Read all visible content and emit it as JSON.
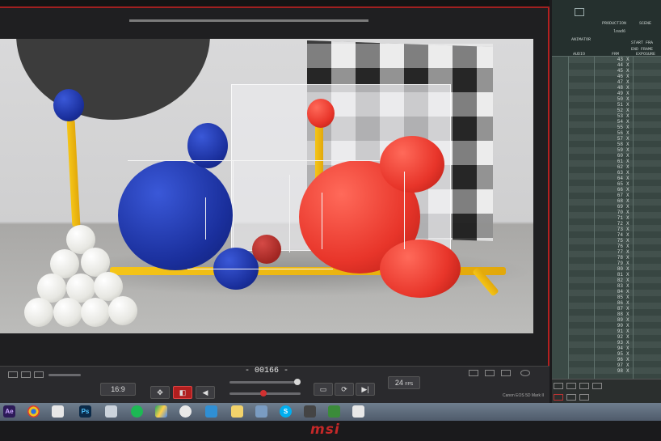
{
  "viewer": {
    "frame_counter": "- 00166 -",
    "aspect_label": "16:9",
    "fps_value": "24",
    "fps_unit": "FPS",
    "camera_label": "Canon EOS 5D Mark II"
  },
  "xsheet": {
    "header": {
      "production_label": "PRODUCTION",
      "scene_label": "SCENE",
      "production_value": "load6",
      "animator_label": "ANIMATOR",
      "start_frame_label": "START FRA",
      "end_frame_label": "END FRAME"
    },
    "columns": [
      "AUDIO",
      "FRM",
      "EXPOSURE"
    ],
    "rows": [
      {
        "frame": "43",
        "exposure": "X"
      },
      {
        "frame": "44",
        "exposure": "X"
      },
      {
        "frame": "45",
        "exposure": "X"
      },
      {
        "frame": "46",
        "exposure": "X"
      },
      {
        "frame": "47",
        "exposure": "X"
      },
      {
        "frame": "48",
        "exposure": "X"
      },
      {
        "frame": "49",
        "exposure": "X"
      },
      {
        "frame": "50",
        "exposure": "X"
      },
      {
        "frame": "51",
        "exposure": "X"
      },
      {
        "frame": "52",
        "exposure": "X"
      },
      {
        "frame": "53",
        "exposure": "X"
      },
      {
        "frame": "54",
        "exposure": "X"
      },
      {
        "frame": "55",
        "exposure": "X"
      },
      {
        "frame": "56",
        "exposure": "X"
      },
      {
        "frame": "57",
        "exposure": "X"
      },
      {
        "frame": "58",
        "exposure": "X"
      },
      {
        "frame": "59",
        "exposure": "X"
      },
      {
        "frame": "60",
        "exposure": "X"
      },
      {
        "frame": "61",
        "exposure": "X"
      },
      {
        "frame": "62",
        "exposure": "X"
      },
      {
        "frame": "63",
        "exposure": "X"
      },
      {
        "frame": "64",
        "exposure": "X"
      },
      {
        "frame": "65",
        "exposure": "X"
      },
      {
        "frame": "66",
        "exposure": "X"
      },
      {
        "frame": "67",
        "exposure": "X"
      },
      {
        "frame": "68",
        "exposure": "X"
      },
      {
        "frame": "69",
        "exposure": "X"
      },
      {
        "frame": "70",
        "exposure": "X"
      },
      {
        "frame": "71",
        "exposure": "X"
      },
      {
        "frame": "72",
        "exposure": "X"
      },
      {
        "frame": "73",
        "exposure": "X"
      },
      {
        "frame": "74",
        "exposure": "X"
      },
      {
        "frame": "75",
        "exposure": "X"
      },
      {
        "frame": "76",
        "exposure": "X"
      },
      {
        "frame": "77",
        "exposure": "X"
      },
      {
        "frame": "78",
        "exposure": "X"
      },
      {
        "frame": "79",
        "exposure": "X"
      },
      {
        "frame": "80",
        "exposure": "X"
      },
      {
        "frame": "81",
        "exposure": "X"
      },
      {
        "frame": "82",
        "exposure": "X"
      },
      {
        "frame": "83",
        "exposure": "X"
      },
      {
        "frame": "84",
        "exposure": "X"
      },
      {
        "frame": "85",
        "exposure": "X"
      },
      {
        "frame": "86",
        "exposure": "X"
      },
      {
        "frame": "87",
        "exposure": "X"
      },
      {
        "frame": "88",
        "exposure": "X"
      },
      {
        "frame": "89",
        "exposure": "X"
      },
      {
        "frame": "90",
        "exposure": "X"
      },
      {
        "frame": "91",
        "exposure": "X"
      },
      {
        "frame": "92",
        "exposure": "X"
      },
      {
        "frame": "93",
        "exposure": "X"
      },
      {
        "frame": "94",
        "exposure": "X"
      },
      {
        "frame": "95",
        "exposure": "X"
      },
      {
        "frame": "96",
        "exposure": "X"
      },
      {
        "frame": "97",
        "exposure": "X"
      },
      {
        "frame": "98",
        "exposure": "X"
      }
    ]
  },
  "taskbar": {
    "apps": [
      "after-effects",
      "chrome",
      "finder",
      "photoshop",
      "unknown-app",
      "spotify",
      "drive",
      "photos",
      "vpn",
      "notes",
      "photos-app",
      "skype",
      "camera",
      "chat",
      "charts",
      "photo-viewer"
    ]
  },
  "monitor": {
    "brand": "msi"
  },
  "colors": {
    "accent_red": "#b01e1e",
    "panel_teal": "#3b4a46"
  }
}
